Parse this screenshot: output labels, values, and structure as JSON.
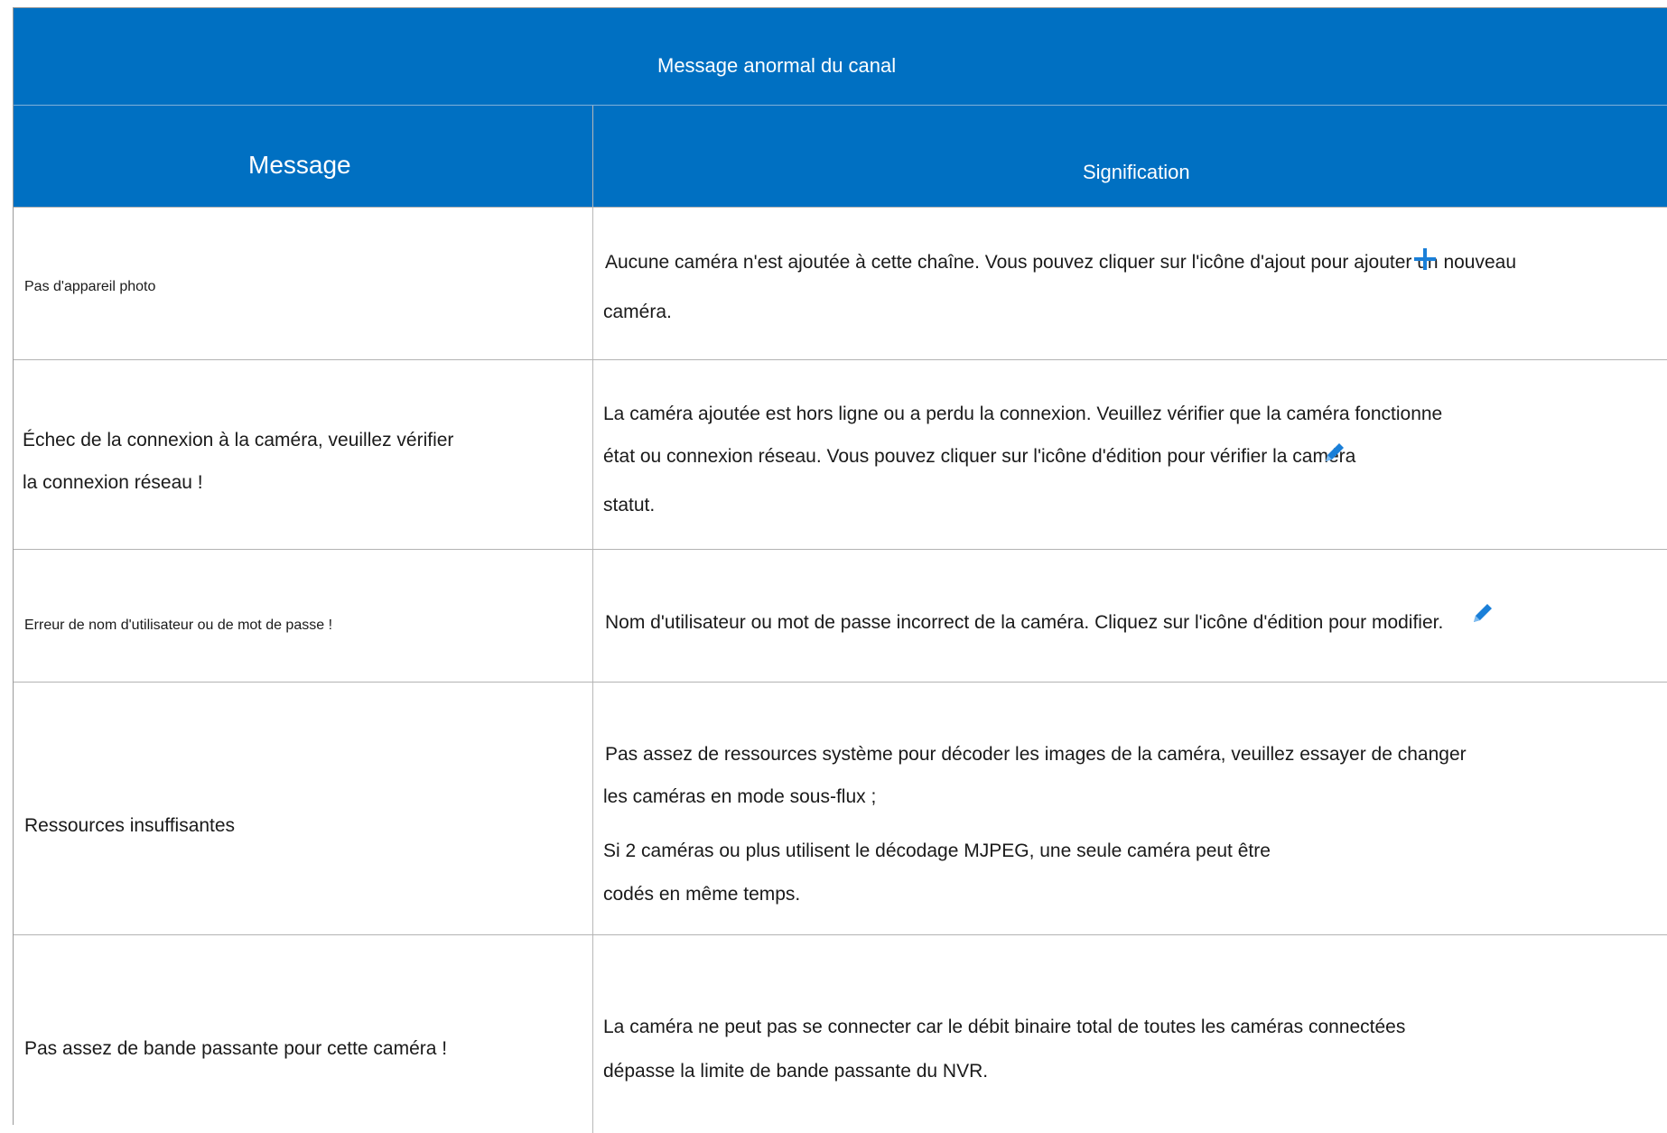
{
  "title": "Message anormal du canal",
  "columns": {
    "message": "Message",
    "meaning": "Signification"
  },
  "rows": [
    {
      "message": "Pas d'appareil photo",
      "meaning_lines": [
        "Aucune caméra n'est ajoutée à cette chaîne. Vous pouvez cliquer sur l'icône d'ajout pour ajouter un nouveau",
        "caméra."
      ],
      "icon": "plus-icon"
    },
    {
      "message_lines": [
        "Échec de la connexion à la caméra, veuillez vérifier",
        "la connexion réseau !"
      ],
      "meaning_lines": [
        "La caméra ajoutée est hors ligne ou a perdu la connexion. Veuillez vérifier que la caméra fonctionne",
        "état ou connexion réseau. Vous pouvez cliquer sur l'icône d'édition pour vérifier la caméra",
        "statut."
      ],
      "icon": "pencil-icon"
    },
    {
      "message": "Erreur de nom d'utilisateur ou de mot de passe !",
      "meaning_lines": [
        "Nom d'utilisateur ou mot de passe incorrect de la caméra. Cliquez sur l'icône d'édition pour modifier."
      ],
      "icon": "pencil-icon"
    },
    {
      "message": "Ressources insuffisantes",
      "meaning_lines": [
        "Pas assez de ressources système pour décoder les images de la caméra, veuillez essayer de changer",
        "les caméras en mode sous-flux ;",
        "Si 2 caméras ou plus utilisent le décodage MJPEG, une seule caméra peut être",
        "codés en même temps."
      ]
    },
    {
      "message": "Pas assez de bande passante pour cette caméra !",
      "meaning_lines": [
        "La caméra ne peut pas se connecter car le débit binaire total de toutes les caméras connectées",
        "dépasse la limite de bande passante du NVR."
      ]
    }
  ],
  "colors": {
    "header_bg": "#0070c2",
    "header_text": "#ffffff",
    "icon": "#1a7fd8",
    "grid": "#b3b3b3"
  }
}
